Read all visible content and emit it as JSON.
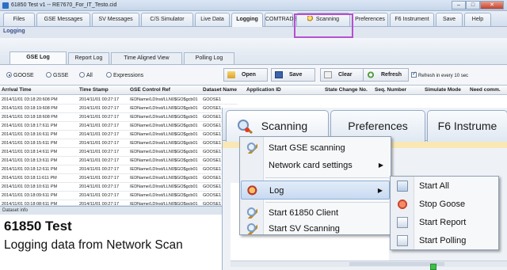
{
  "window": {
    "title": "61850 Test v1 -- RE7670_For_IT_Testo.cid"
  },
  "menu_tabs": [
    {
      "label": "Files"
    },
    {
      "label": "GSE Messages"
    },
    {
      "label": "SV Messages"
    },
    {
      "label": "C/S Simulator"
    },
    {
      "label": "Live Data"
    },
    {
      "label": "Logging"
    },
    {
      "label": "COMTRADE"
    },
    {
      "label": "Scanning"
    },
    {
      "label": "Preferences"
    },
    {
      "label": "F6 Instrument"
    },
    {
      "label": "Save"
    },
    {
      "label": "Help"
    }
  ],
  "section_label": "Logging",
  "sub_tabs": [
    {
      "label": "GSE Log"
    },
    {
      "label": "Report Log"
    },
    {
      "label": "Time Aligned View"
    },
    {
      "label": "Polling Log"
    }
  ],
  "filters": {
    "goose": "GOOSE",
    "gsse": "GSSE",
    "all": "All",
    "expressions": "Expressions"
  },
  "toolbar": {
    "open": "Open",
    "save": "Save",
    "clear": "Clear",
    "refresh": "Refresh",
    "auto_refresh": "Refresh in every 10 sec"
  },
  "grid": {
    "columns": [
      "Arrival Time",
      "Time Stamp",
      "GSE Control Ref",
      "Dataset Name",
      "Application ID",
      "State Change No.",
      "Seq. Number",
      "Simulate Mode",
      "Need comm."
    ],
    "rows": [
      [
        "2014/11/01 03:18:20:608 PM",
        "2014/11/01 00:27:17",
        "IEDName/LDInst/LLN0$GO$gcb01",
        "GOOSE1"
      ],
      [
        "2014/11/01 03:18:19:608 PM",
        "2014/11/01 00:27:17",
        "IEDName/LDInst/LLN0$GO$gcb01",
        "GOOSE1"
      ],
      [
        "2014/11/01 03:18:18:608 PM",
        "2014/11/01 00:27:17",
        "IEDName/LDInst/LLN0$GO$gcb01",
        "GOOSE1"
      ],
      [
        "2014/11/01 03:18:17:611 PM",
        "2014/11/01 00:27:17",
        "IEDName/LDInst/LLN0$GO$gcb01",
        "GOOSE1"
      ],
      [
        "2014/11/01 03:18:16:611 PM",
        "2014/11/01 00:27:17",
        "IEDName/LDInst/LLN0$GO$gcb01",
        "GOOSE1"
      ],
      [
        "2014/11/01 03:18:15:611 PM",
        "2014/11/01 00:27:17",
        "IEDName/LDInst/LLN0$GO$gcb01",
        "GOOSE1"
      ],
      [
        "2014/11/01 03:18:14:611 PM",
        "2014/11/01 00:27:17",
        "IEDName/LDInst/LLN0$GO$gcb01",
        "GOOSE1"
      ],
      [
        "2014/11/01 03:18:13:611 PM",
        "2014/11/01 00:27:17",
        "IEDName/LDInst/LLN0$GO$gcb01",
        "GOOSE1"
      ],
      [
        "2014/11/01 03:18:12:611 PM",
        "2014/11/01 00:27:17",
        "IEDName/LDInst/LLN0$GO$gcb01",
        "GOOSE1"
      ],
      [
        "2014/11/01 03:18:11:611 PM",
        "2014/11/01 00:27:17",
        "IEDName/LDInst/LLN0$GO$gcb01",
        "GOOSE1"
      ],
      [
        "2014/11/01 03:18:10:611 PM",
        "2014/11/01 00:27:17",
        "IEDName/LDInst/LLN0$GO$gcb01",
        "GOOSE1"
      ],
      [
        "2014/11/01 03:18:09:611 PM",
        "2014/11/01 00:27:17",
        "IEDName/LDInst/LLN0$GO$gcb01",
        "GOOSE1"
      ],
      [
        "2014/11/01 03:18:08:611 PM",
        "2014/11/01 00:27:17",
        "IEDName/LDInst/LLN0$GO$gcb01",
        "GOOSE1"
      ]
    ]
  },
  "dataset_info": {
    "header": "Dataset info",
    "title": "61850 Test",
    "subtitle": "Logging data from Network Scan"
  },
  "zoom_tabs": {
    "scanning": "Scanning",
    "preferences": "Preferences",
    "f6": "F6 Instrume"
  },
  "context_menu": {
    "items": [
      "Start GSE scanning",
      "Network card settings",
      "Log",
      "Start 61850 Client",
      "Start SV Scanning"
    ]
  },
  "log_submenu": {
    "items": [
      "Start All",
      "Stop Goose",
      "Start Report",
      "Start Polling"
    ]
  },
  "colors": {
    "highlight_box": "#b64fd0",
    "arrow": "#8a4bc4"
  }
}
